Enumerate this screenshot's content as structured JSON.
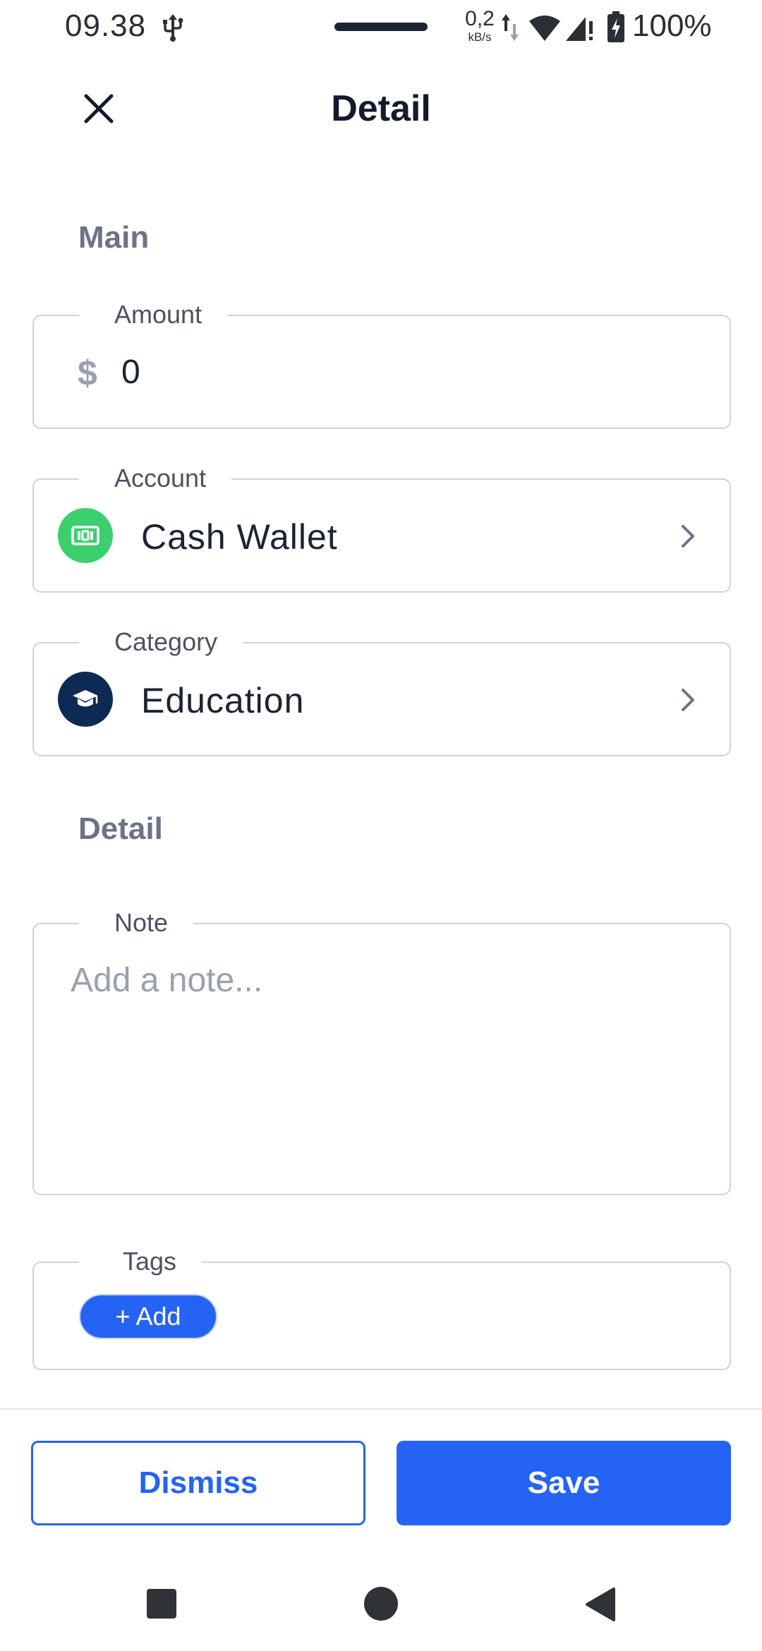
{
  "status_bar": {
    "time": "09.38",
    "net_speed_value": "0,2",
    "net_speed_unit": "kB/s",
    "battery": "100%"
  },
  "header": {
    "title": "Detail",
    "close_icon": "close-icon"
  },
  "sections": {
    "main_title": "Main",
    "detail_title": "Detail"
  },
  "amount": {
    "label": "Amount",
    "currency": "$",
    "value": "0"
  },
  "account": {
    "label": "Account",
    "value": "Cash Wallet",
    "icon": "banknote-icon",
    "icon_color": "#3ccf6e"
  },
  "category": {
    "label": "Category",
    "value": "Education",
    "icon": "graduation-cap-icon",
    "icon_color": "#0d2a52"
  },
  "note": {
    "label": "Note",
    "placeholder": "Add a note..."
  },
  "tags": {
    "label": "Tags",
    "add_label": "+ Add"
  },
  "footer": {
    "dismiss_label": "Dismiss",
    "save_label": "Save",
    "accent_color": "#2563f5"
  },
  "nav_bar": {
    "recents_icon": "square-icon",
    "home_icon": "circle-icon",
    "back_icon": "triangle-back-icon"
  }
}
